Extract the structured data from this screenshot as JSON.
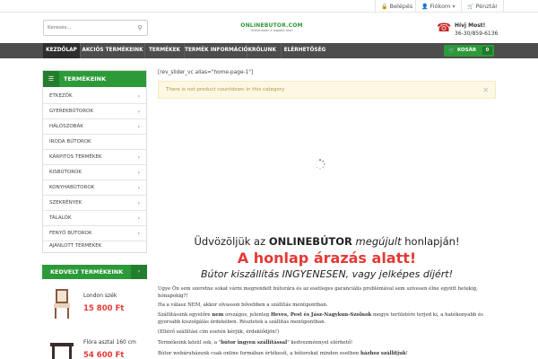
{
  "topbar": {
    "login": "Belépés",
    "account": "Fiókom",
    "currency": "Pénztár"
  },
  "search": {
    "placeholder": "Keresés..."
  },
  "logo": {
    "name": "ONLINEBUTOR.COM",
    "tagline": "Otthonában a legjobb árak"
  },
  "phone": {
    "label": "Hívj Most!",
    "number": "36-30/859-6136"
  },
  "nav": {
    "items": [
      {
        "label": "KEZDŐLAP",
        "active": true
      },
      {
        "label": "AKCIÓS TERMÉKEINK"
      },
      {
        "label": "TERMÉKEK"
      },
      {
        "label": "TERMÉK INFORMÁCIÓK"
      },
      {
        "label": "RÓLUNK"
      },
      {
        "label": "ELÉRHETŐSÉG"
      }
    ],
    "cart_label": "KOSÁR",
    "cart_count": "0"
  },
  "sidebar": {
    "title": "TERMÉKEINK",
    "categories": [
      {
        "label": "ÉTKEZŐK",
        "has_sub": true
      },
      {
        "label": "GYEREKBÚTOROK",
        "has_sub": true
      },
      {
        "label": "HÁLÓSZOBÁK",
        "has_sub": true
      },
      {
        "label": "IRODA BÚTOROK",
        "has_sub": false
      },
      {
        "label": "KÁRPITOS TERMÉKEK",
        "has_sub": true
      },
      {
        "label": "KISBÚTOROK",
        "has_sub": true
      },
      {
        "label": "KONYHABÚTOROK",
        "has_sub": true
      },
      {
        "label": "SZEKRÉNYEK",
        "has_sub": true
      },
      {
        "label": "TÁLALÓK",
        "has_sub": true
      },
      {
        "label": "FENYŐ BÚTOROK",
        "has_sub": true
      },
      {
        "label": "AJÁNLOTT TERMÉKEK",
        "has_sub": false
      }
    ],
    "favorites_title": "KEDVELT TERMÉKEINK",
    "products": [
      {
        "name": "London szék",
        "price": "15 800 Ft"
      },
      {
        "name": "Flóra asztal 160 cm",
        "price": "54 600 Ft"
      }
    ]
  },
  "main": {
    "shortcode": "[rev_slider_vc alias=\"home-page-1\"]",
    "notice": "There is not product countdown in this category",
    "welcome_pre": "Üdvözöljük az ",
    "welcome_brand": "ONLINEBÚTOR",
    "welcome_em": " megújult",
    "welcome_post": " honlapján!",
    "headline": "A honlap árazás alatt!",
    "subline": "Bútor kiszállítás INGYENESEN, vagy jelképes díjért!",
    "p1": "Ugye Ön sem szeretne sokat várni megrendelt bútorára és az esetleges garanciális problémával sem szívesen élne együtt hetekig, hónapokig?!",
    "p2_a": "Ha a válasz ",
    "p2_b": "NEM",
    "p2_c": ", akkor olvasson bővebben a szállítás menüpontban.",
    "p3_a": "Szállításunk egyelőre ",
    "p3_b": "nem",
    "p3_c": " országos, jelenleg ",
    "p3_d": "Heves, Pest és Jász-Nagykun-Szolnok",
    "p3_e": " megye területére terjed ki, a hatékonyabb és gyorsabb kiszolgálás érdekében. Részletek a szállítás menüpontban.",
    "p4": "(Eltérő szállítási cím esetén kérjük, érdeklődjön!)",
    "p5_a": "Termékeink közül sok, a \"",
    "p5_b": "bútor ingyen szállítással",
    "p5_c": "\" kedvezménnyel elérhető!",
    "p6_a": "Bútor webáruházunk csak online formában értékesít, a bútorokat minden esetben ",
    "p6_b": "házhoz szállítjuk",
    "p6_c": "!"
  },
  "colors": {
    "accent": "#2c9a38",
    "nav": "#4d4d4d",
    "price": "#e53935"
  }
}
